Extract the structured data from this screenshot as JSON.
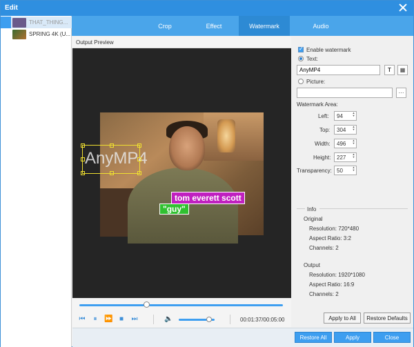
{
  "window": {
    "title": "Edit"
  },
  "files": [
    {
      "name": "THAT_THING...",
      "selected": true,
      "thumb_color": "#6a5a8a"
    },
    {
      "name": "SPRING 4K (U...",
      "selected": false,
      "thumb_color": "#8a6030"
    }
  ],
  "tabs": [
    {
      "label": "Crop",
      "active": false
    },
    {
      "label": "Effect",
      "active": false
    },
    {
      "label": "Watermark",
      "active": true
    },
    {
      "label": "Audio",
      "active": false
    }
  ],
  "preview": {
    "header": "Output Preview",
    "watermark_text": "AnyMP4",
    "caption_1": "tom everett scott",
    "caption_2": "\"guy\""
  },
  "player": {
    "timecode": "00:01:37/00:05:00",
    "progress": 0.33,
    "volume": 0.85
  },
  "watermark": {
    "enable_label": "Enable watermark",
    "enable_checked": true,
    "text_label": "Text:",
    "text_value": "AnyMP4",
    "text_selected": true,
    "picture_label": "Picture:",
    "picture_value": "",
    "area_label": "Watermark Area:",
    "left_label": "Left:",
    "left_value": "94",
    "top_label": "Top:",
    "top_value": "304",
    "width_label": "Width:",
    "width_value": "496",
    "height_label": "Height:",
    "height_value": "227",
    "transparency_label": "Transparency:",
    "transparency_value": "50"
  },
  "info": {
    "title": "Info",
    "original_title": "Original",
    "original_resolution": "Resolution: 720*480",
    "original_aspect": "Aspect Ratio: 3:2",
    "original_channels": "Channels: 2",
    "output_title": "Output",
    "output_resolution": "Resolution: 1920*1080",
    "output_aspect": "Aspect Ratio: 16:9",
    "output_channels": "Channels: 2"
  },
  "buttons": {
    "apply_to_all": "Apply to All",
    "restore_defaults": "Restore Defaults",
    "restore_all": "Restore All",
    "apply": "Apply",
    "close": "Close"
  },
  "colors": {
    "accent": "#3d9ef0",
    "titlebar": "#2f8fe0",
    "tabbar": "#4aa5ea"
  }
}
